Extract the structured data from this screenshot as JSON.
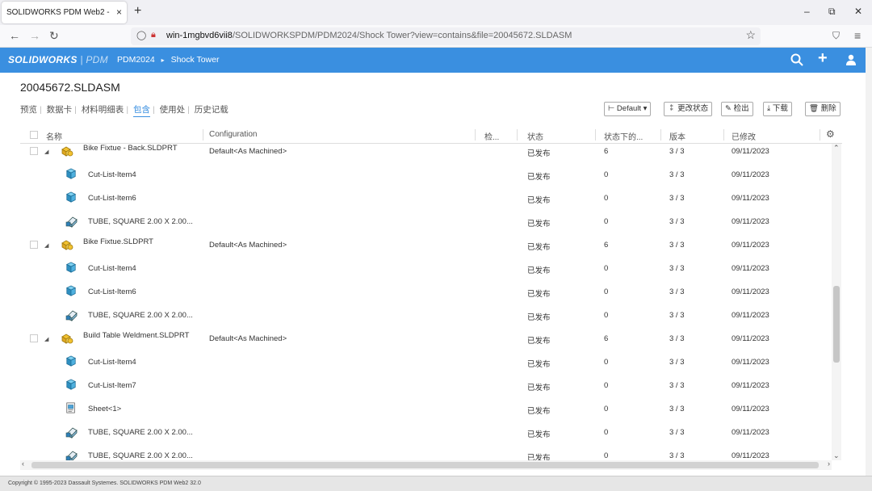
{
  "browser": {
    "tab_title": "SOLIDWORKS PDM Web2 - PDM",
    "tab_close": "×",
    "new_tab": "+",
    "url_host": "win-1mgbvd6vii8",
    "url_rest": "/SOLIDWORKSPDM/PDM2024/Shock Tower?view=contains&file=20045672.SLDASM",
    "window_controls": [
      "–",
      "⧉",
      "✕"
    ]
  },
  "header": {
    "logo": "SOLIDWORKS",
    "logo_sub": "| PDM",
    "breadcrumb_vault": "PDM2024",
    "breadcrumb_sep": "▸",
    "breadcrumb_folder": "Shock Tower",
    "accent_color": "#3a8fe0"
  },
  "file": {
    "name": "20045672.SLDASM"
  },
  "tabs": [
    "预览",
    "数据卡",
    "材料明细表",
    "包含",
    "使用处",
    "历史记载"
  ],
  "toolbar": {
    "config": "Default",
    "change_state": "更改状态",
    "check_out": "检出",
    "download": "下载",
    "delete": "删除"
  },
  "columns": {
    "name": "名称",
    "configuration": "Configuration",
    "checked": "检...",
    "state": "状态",
    "state_under": "状态下的...",
    "version": "版本",
    "modified": "已修改"
  },
  "rows": [
    {
      "type": "parent",
      "icon": "part-assembly-icon",
      "name": "Bike Fixtue - Back.SLDPRT",
      "config": "Default<As Machined>",
      "state": "已发布",
      "count": "6",
      "version": "3 / 3",
      "date": "09/11/2023"
    },
    {
      "type": "child",
      "icon": "cut-list-item-icon",
      "name": "Cut-List-Item4",
      "config": "",
      "state": "已发布",
      "count": "0",
      "version": "3 / 3",
      "date": "09/11/2023"
    },
    {
      "type": "child",
      "icon": "cut-list-item-icon",
      "name": "Cut-List-Item6",
      "config": "",
      "state": "已发布",
      "count": "0",
      "version": "3 / 3",
      "date": "09/11/2023"
    },
    {
      "type": "child",
      "icon": "tube-profile-icon",
      "name": "TUBE, SQUARE 2.00 X 2.00...",
      "config": "",
      "state": "已发布",
      "count": "0",
      "version": "3 / 3",
      "date": "09/11/2023"
    },
    {
      "type": "parent",
      "icon": "part-assembly-icon",
      "name": "Bike Fixtue.SLDPRT",
      "config": "Default<As Machined>",
      "state": "已发布",
      "count": "6",
      "version": "3 / 3",
      "date": "09/11/2023"
    },
    {
      "type": "child",
      "icon": "cut-list-item-icon",
      "name": "Cut-List-Item4",
      "config": "",
      "state": "已发布",
      "count": "0",
      "version": "3 / 3",
      "date": "09/11/2023"
    },
    {
      "type": "child",
      "icon": "cut-list-item-icon",
      "name": "Cut-List-Item6",
      "config": "",
      "state": "已发布",
      "count": "0",
      "version": "3 / 3",
      "date": "09/11/2023"
    },
    {
      "type": "child",
      "icon": "tube-profile-icon",
      "name": "TUBE, SQUARE 2.00 X 2.00...",
      "config": "",
      "state": "已发布",
      "count": "0",
      "version": "3 / 3",
      "date": "09/11/2023"
    },
    {
      "type": "parent",
      "icon": "part-assembly-icon",
      "name": "Build Table Weldment.SLDPRT",
      "config": "Default<As Machined>",
      "state": "已发布",
      "count": "6",
      "version": "3 / 3",
      "date": "09/11/2023"
    },
    {
      "type": "child",
      "icon": "cut-list-item-icon",
      "name": "Cut-List-Item4",
      "config": "",
      "state": "已发布",
      "count": "0",
      "version": "3 / 3",
      "date": "09/11/2023"
    },
    {
      "type": "child",
      "icon": "cut-list-item-icon",
      "name": "Cut-List-Item7",
      "config": "",
      "state": "已发布",
      "count": "0",
      "version": "3 / 3",
      "date": "09/11/2023"
    },
    {
      "type": "child",
      "icon": "sheet-metal-icon",
      "name": "Sheet<1>",
      "config": "",
      "state": "已发布",
      "count": "0",
      "version": "3 / 3",
      "date": "09/11/2023"
    },
    {
      "type": "child",
      "icon": "tube-profile-icon",
      "name": "TUBE, SQUARE 2.00 X 2.00...",
      "config": "",
      "state": "已发布",
      "count": "0",
      "version": "3 / 3",
      "date": "09/11/2023"
    },
    {
      "type": "child",
      "icon": "tube-profile-icon",
      "name": "TUBE, SQUARE 2.00 X 2.00...",
      "config": "",
      "state": "已发布",
      "count": "0",
      "version": "3 / 3",
      "date": "09/11/2023"
    }
  ],
  "footer": "Copyright © 1995-2023 Dassault Systemes. SOLIDWORKS PDM Web2 32.0"
}
